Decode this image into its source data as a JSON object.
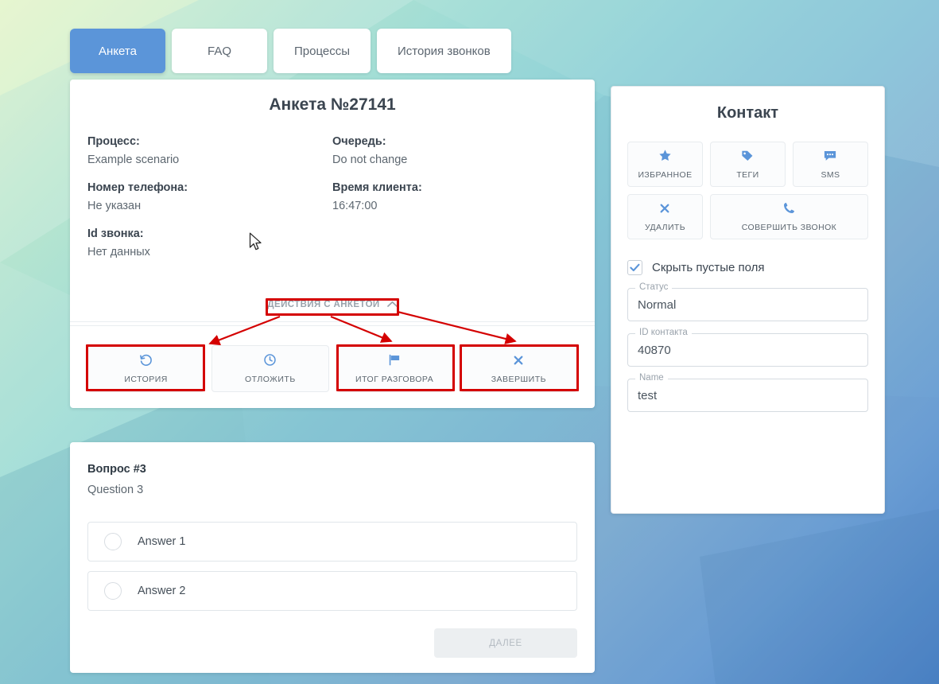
{
  "tabs": [
    {
      "label": "Анкета",
      "active": true
    },
    {
      "label": "FAQ",
      "active": false
    },
    {
      "label": "Процессы",
      "active": false
    },
    {
      "label": "История звонков",
      "active": false
    }
  ],
  "profile": {
    "title": "Анкета №27141",
    "fields": [
      {
        "label": "Процесс:",
        "value": "Example scenario"
      },
      {
        "label": "Очередь:",
        "value": "Do not change"
      },
      {
        "label": "Номер телефона:",
        "value": "Не указан"
      },
      {
        "label": "Время клиента:",
        "value": "16:47:00"
      },
      {
        "label": "Id звонка:",
        "value": "Нет данных"
      }
    ],
    "actions_toggle_label": "ДЕЙСТВИЯ С АНКЕТОЙ",
    "actions_toggle_icon": "chevron-up-icon",
    "actions": [
      {
        "label": "ИСТОРИЯ",
        "icon": "history-icon"
      },
      {
        "label": "ОТЛОЖИТЬ",
        "icon": "clock-icon"
      },
      {
        "label": "ИТОГ РАЗГОВОРА",
        "icon": "flag-icon"
      },
      {
        "label": "ЗАВЕРШИТЬ",
        "icon": "close-x-icon"
      }
    ]
  },
  "question": {
    "number_label": "Вопрос #3",
    "text": "Question 3",
    "answers": [
      {
        "label": "Answer 1",
        "selected": false
      },
      {
        "label": "Answer 2",
        "selected": false
      }
    ],
    "next_label": "ДАЛЕЕ"
  },
  "contact": {
    "title": "Контакт",
    "buttons": [
      {
        "label": "ИЗБРАННОЕ",
        "icon": "star-icon"
      },
      {
        "label": "ТЕГИ",
        "icon": "tag-icon"
      },
      {
        "label": "SMS",
        "icon": "chat-bubble-icon"
      },
      {
        "label": "УДАЛИТЬ",
        "icon": "close-x-icon"
      },
      {
        "label": "СОВЕРШИТЬ ЗВОНОК",
        "icon": "phone-icon"
      }
    ],
    "hide_empty": {
      "label": "Скрыть пустые поля",
      "checked": true
    },
    "fields": [
      {
        "legend": "Статус",
        "value": "Normal"
      },
      {
        "legend": "ID контакта",
        "value": "40870"
      },
      {
        "legend": "Name",
        "value": "test"
      }
    ]
  },
  "colors": {
    "accent_blue": "#5b95d9",
    "annotation_red": "#d40000",
    "text_dark": "#3b4550",
    "text_muted": "#5d6770"
  }
}
